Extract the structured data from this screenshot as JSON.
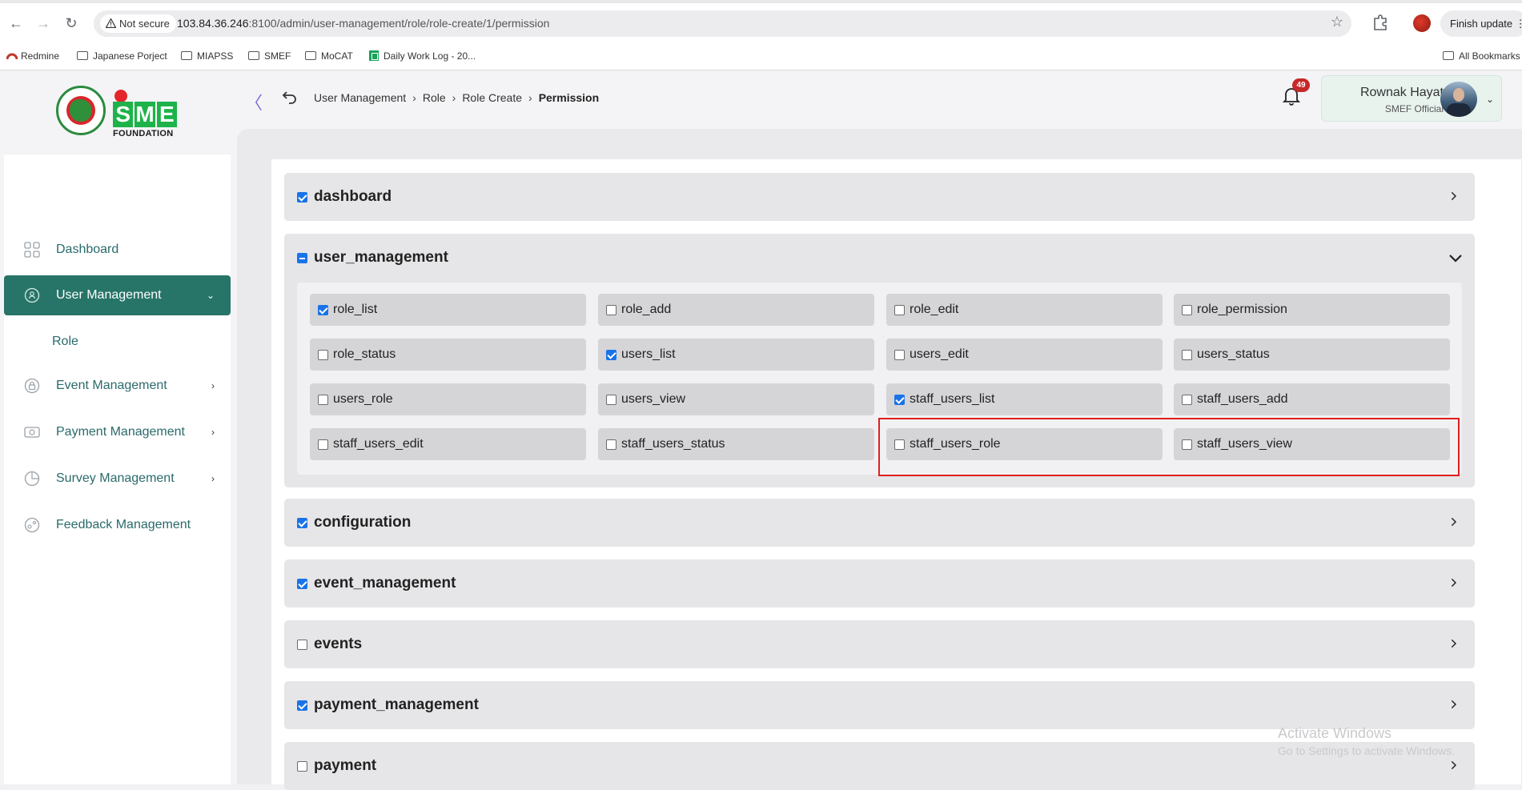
{
  "browser": {
    "security_label": "Not secure",
    "url_host": "103.84.36.246",
    "url_rest": ":8100/admin/user-management/role/role-create/1/permission",
    "update_label": "Finish update",
    "bookmarks": [
      "Redmine",
      "Japanese Porject",
      "MIAPSS",
      "SMEF",
      "MoCAT",
      "Daily Work Log - 20...",
      "All Bookmarks"
    ]
  },
  "logo": {
    "letters": [
      "S",
      "M",
      "E"
    ],
    "subtitle": "FOUNDATION"
  },
  "sidebar": {
    "items": [
      {
        "label": "Dashboard"
      },
      {
        "label": "User Management"
      },
      {
        "label": "Event Management"
      },
      {
        "label": "Payment Management"
      },
      {
        "label": "Survey Management"
      },
      {
        "label": "Feedback Management"
      }
    ],
    "sub_items": [
      {
        "label": "Role"
      }
    ]
  },
  "header": {
    "breadcrumb": [
      "User Management",
      "Role",
      "Role Create",
      "Permission"
    ],
    "notification_count": "49",
    "user_name": "Rownak Hayat",
    "user_role": "SMEF Official"
  },
  "sections": [
    {
      "name": "dashboard",
      "state": "checked"
    },
    {
      "name": "user_management",
      "state": "mixed"
    },
    {
      "name": "configuration",
      "state": "checked"
    },
    {
      "name": "event_management",
      "state": "checked"
    },
    {
      "name": "events",
      "state": "unchecked"
    },
    {
      "name": "payment_management",
      "state": "checked"
    },
    {
      "name": "payment",
      "state": "unchecked"
    }
  ],
  "permissions": [
    {
      "name": "role_list",
      "checked": true
    },
    {
      "name": "role_add",
      "checked": false
    },
    {
      "name": "role_edit",
      "checked": false
    },
    {
      "name": "role_permission",
      "checked": false
    },
    {
      "name": "role_status",
      "checked": false
    },
    {
      "name": "users_list",
      "checked": true
    },
    {
      "name": "users_edit",
      "checked": false
    },
    {
      "name": "users_status",
      "checked": false
    },
    {
      "name": "users_role",
      "checked": false
    },
    {
      "name": "users_view",
      "checked": false
    },
    {
      "name": "staff_users_list",
      "checked": true
    },
    {
      "name": "staff_users_add",
      "checked": false
    },
    {
      "name": "staff_users_edit",
      "checked": false
    },
    {
      "name": "staff_users_status",
      "checked": false
    },
    {
      "name": "staff_users_role",
      "checked": false
    },
    {
      "name": "staff_users_view",
      "checked": false
    }
  ],
  "watermark": {
    "title": "Activate Windows",
    "subtitle": "Go to Settings to activate Windows."
  },
  "colors": {
    "accent": "#277468",
    "checkbox": "#1a73e8",
    "highlight": "#e01e1e",
    "badge": "#c62828"
  }
}
